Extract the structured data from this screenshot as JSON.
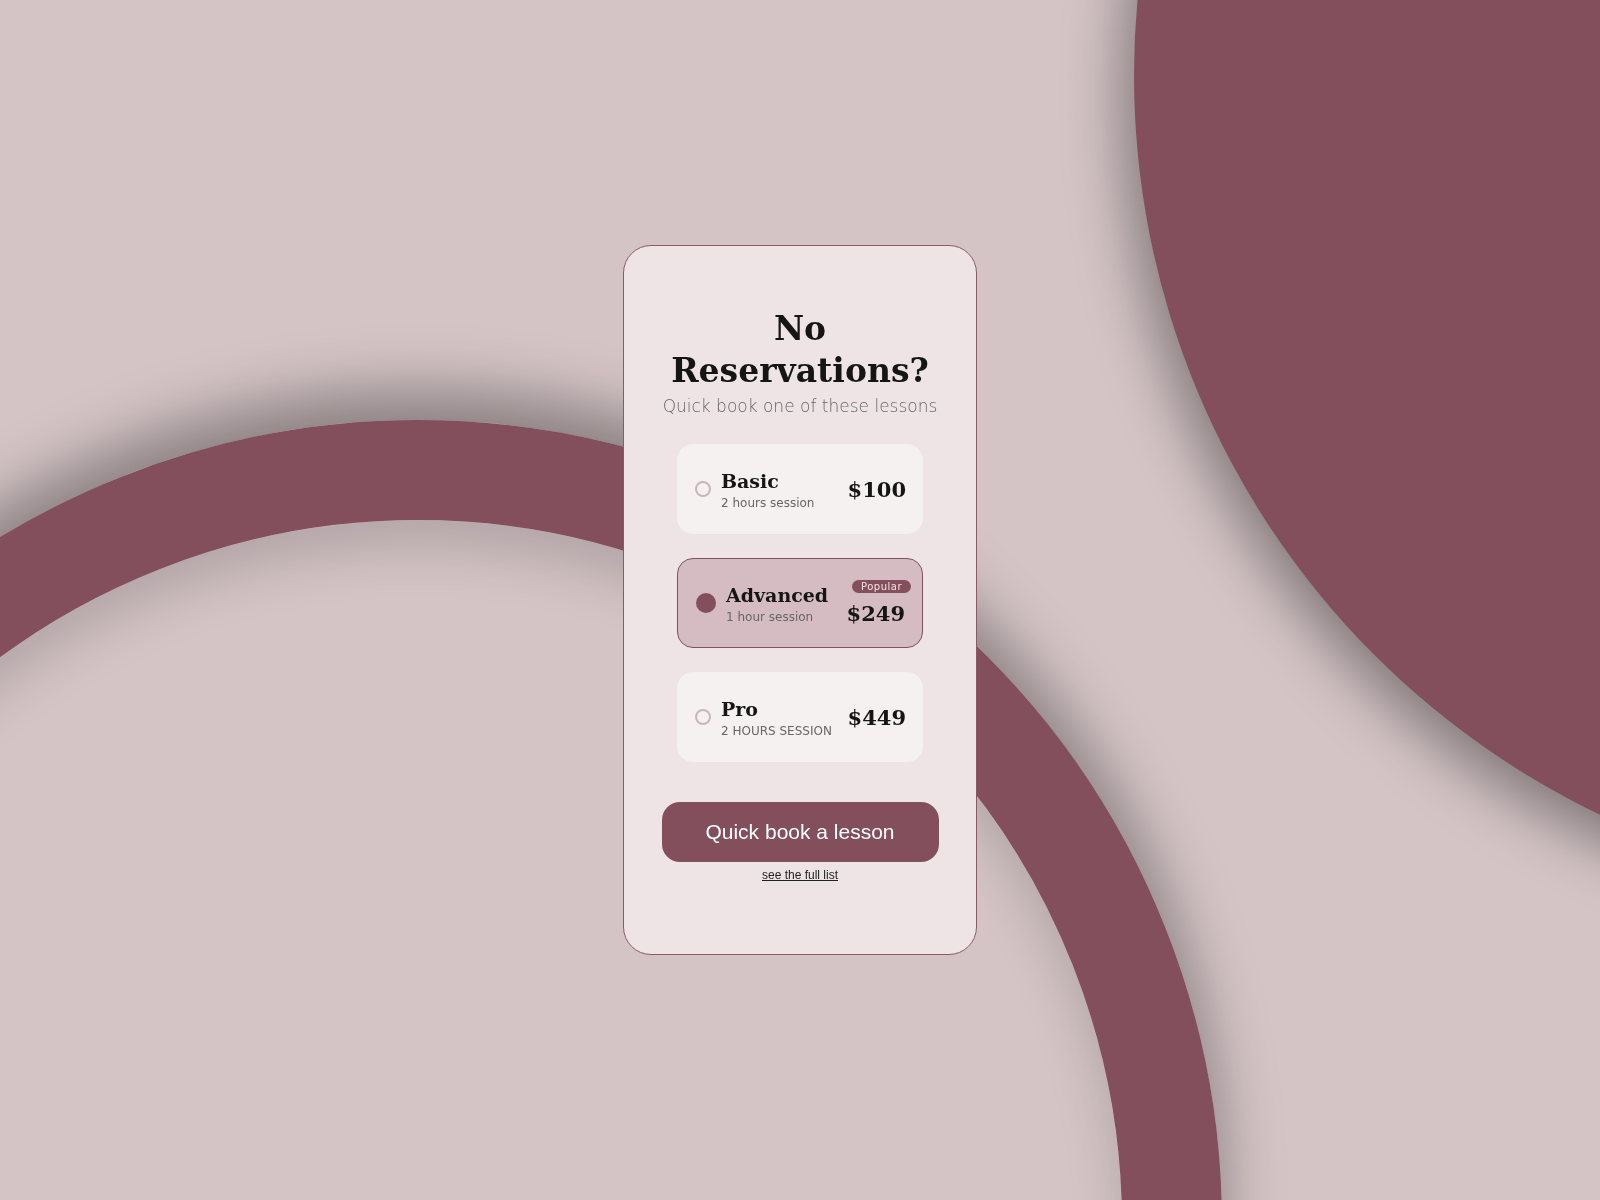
{
  "card": {
    "title": "No Reservations?",
    "subtitle": "Quick book one of these lessons"
  },
  "options": [
    {
      "name": "Basic",
      "detail": "2 hours session",
      "price": "$100",
      "selected": false
    },
    {
      "name": "Advanced",
      "detail": "1 hour session",
      "price": "$249",
      "selected": true,
      "badge": "Popular"
    },
    {
      "name": "Pro",
      "detail": "2 HOURS SESSION",
      "price": "$449",
      "selected": false
    }
  ],
  "button": "Quick book a lesson",
  "link": "see the full list"
}
